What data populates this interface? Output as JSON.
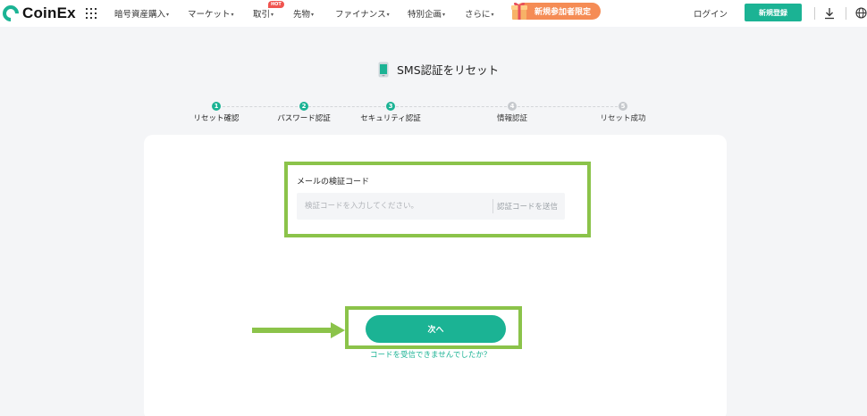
{
  "header": {
    "brand": "CoinEx",
    "nav": [
      {
        "label": "暗号資産購入",
        "caret": "▾"
      },
      {
        "label": "マーケット",
        "caret": "▾"
      },
      {
        "label": "取引",
        "caret": "▾"
      },
      {
        "label": "先物",
        "caret": "▾"
      },
      {
        "label": "ファイナンス",
        "caret": "▾"
      },
      {
        "label": "特別企画",
        "caret": "▾"
      },
      {
        "label": "さらに",
        "caret": "▾"
      }
    ],
    "hot_badge": "HOT",
    "promo": "新規参加者限定",
    "login": "ログイン",
    "register": "新規登録",
    "icons": [
      "apps-grid-icon",
      "gift-icon",
      "download-icon",
      "globe-icon"
    ]
  },
  "page": {
    "title": "SMS認証をリセット",
    "title_icon": "phone-icon"
  },
  "steps": [
    {
      "number": "1",
      "label": "リセット確認",
      "status": "done"
    },
    {
      "number": "2",
      "label": "パスワード認証",
      "status": "done"
    },
    {
      "number": "3",
      "label": "セキュリティ認証",
      "status": "done"
    },
    {
      "number": "4",
      "label": "情報認証",
      "status": "todo"
    },
    {
      "number": "5",
      "label": "リセット成功",
      "status": "todo"
    }
  ],
  "form": {
    "email_code_label": "メールの検証コード",
    "email_code_value": "",
    "email_code_placeholder": "検証コードを入力してください。",
    "send_code": "認証コードを送信",
    "next_button": "次へ",
    "help_link": "コードを受信できませんでしたか？"
  },
  "colors": {
    "accent": "#1bb394",
    "highlight": "#8bc34a",
    "promo": "#f58c55",
    "hot": "#f0544f"
  }
}
